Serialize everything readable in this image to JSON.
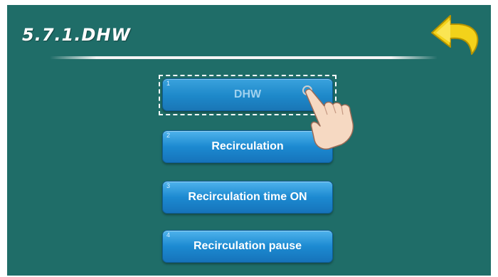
{
  "header": {
    "title": "5.7.1.DHW"
  },
  "icons": {
    "back": "back-arrow-icon",
    "pointer": "pointing-hand-icon"
  },
  "colors": {
    "background": "#1f6d68",
    "button": "#1c8ad1",
    "back_arrow": "#f2d000"
  },
  "menu": {
    "items": [
      {
        "number": "1",
        "label": "DHW",
        "selected": true
      },
      {
        "number": "2",
        "label": "Recirculation",
        "selected": false
      },
      {
        "number": "3",
        "label": "Recirculation time ON",
        "selected": false
      },
      {
        "number": "4",
        "label": "Recirculation pause",
        "selected": false
      }
    ]
  }
}
